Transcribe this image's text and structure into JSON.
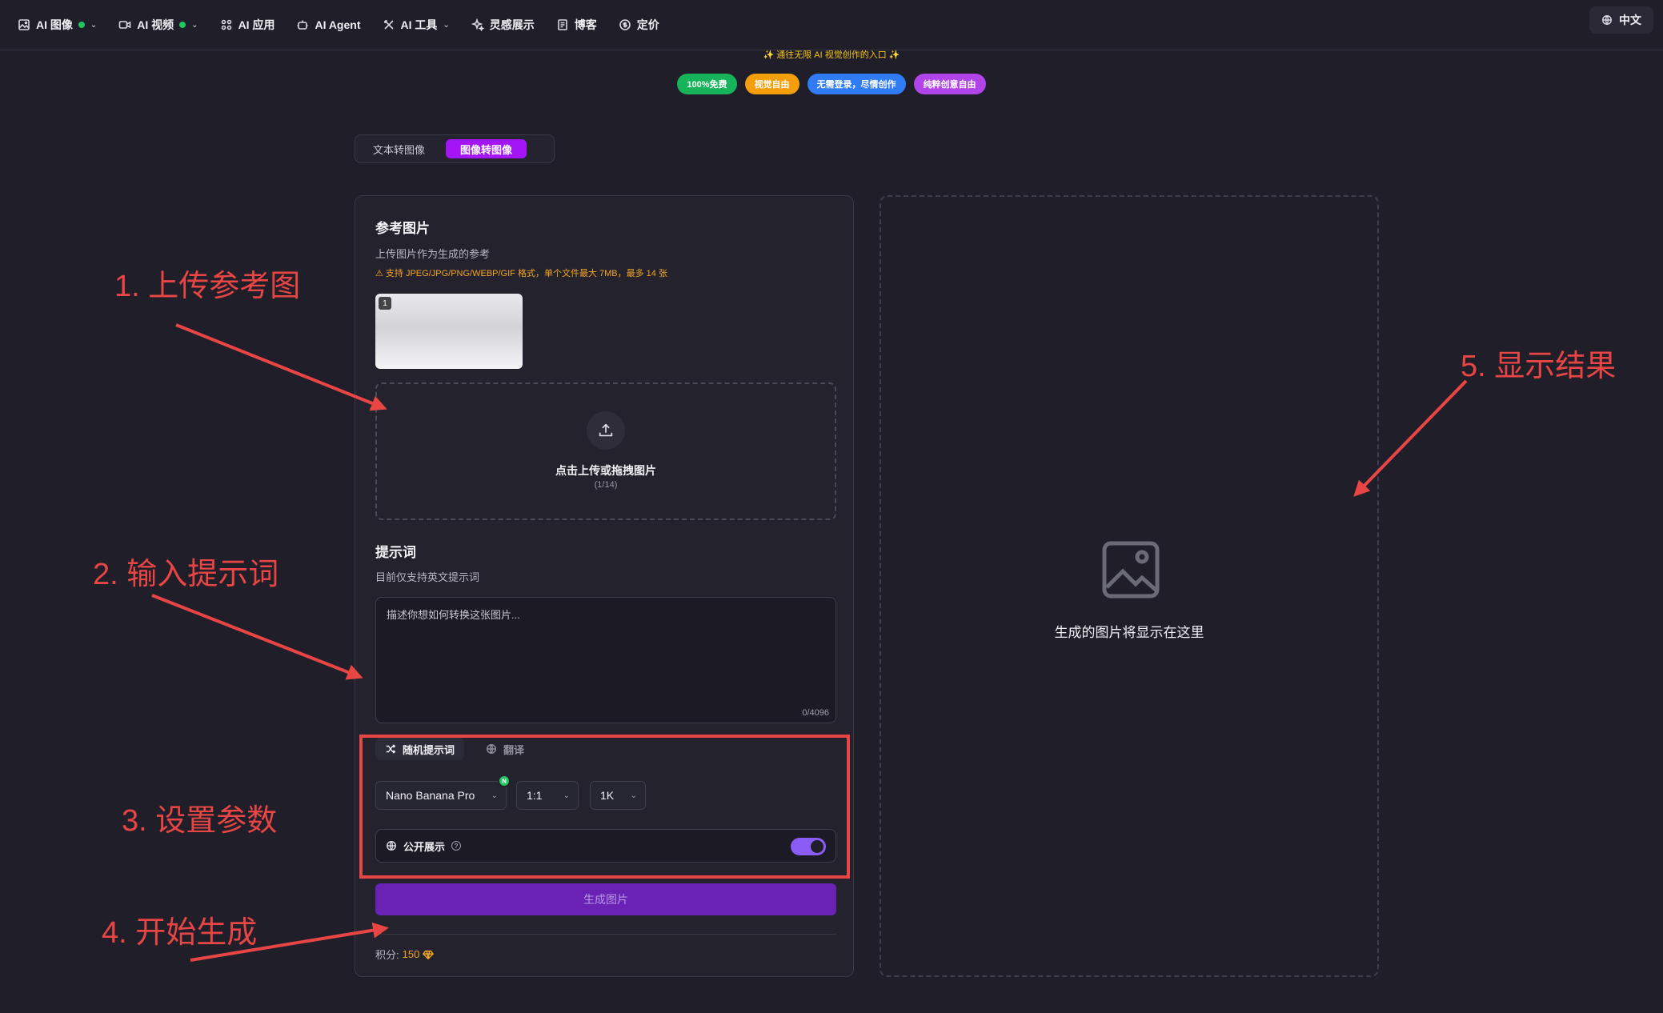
{
  "nav": {
    "items": [
      {
        "label": "AI 图像",
        "icon": "image-icon",
        "dot": true,
        "chevron": true
      },
      {
        "label": "AI 视频",
        "icon": "video-icon",
        "dot": true,
        "chevron": true
      },
      {
        "label": "AI 应用",
        "icon": "grid-icon",
        "dot": false,
        "chevron": false
      },
      {
        "label": "AI Agent",
        "icon": "robot-icon",
        "dot": false,
        "chevron": false
      },
      {
        "label": "AI 工具",
        "icon": "tools-icon",
        "dot": false,
        "chevron": true
      },
      {
        "label": "灵感展示",
        "icon": "sparkle-icon",
        "dot": false,
        "chevron": false
      },
      {
        "label": "博客",
        "icon": "document-icon",
        "dot": false,
        "chevron": false
      },
      {
        "label": "定价",
        "icon": "coin-icon",
        "dot": false,
        "chevron": false
      }
    ],
    "language": "中文"
  },
  "hero": {
    "tagline": "✨ 通往无限 AI 视觉创作的入口 ✨",
    "badges": [
      {
        "label": "100%免费",
        "color": "#16b35a"
      },
      {
        "label": "视觉自由",
        "color": "#f59e0b"
      },
      {
        "label": "无需登录，尽情创作",
        "color": "#2f7cf6"
      },
      {
        "label": "纯粹创意自由",
        "color": "#b044e8"
      }
    ]
  },
  "mode_tabs": {
    "text_to_image": "文本转图像",
    "image_to_image": "图像转图像",
    "active": "image_to_image"
  },
  "reference": {
    "title": "参考图片",
    "subtitle": "上传图片作为生成的参考",
    "warning": "⚠ 支持 JPEG/JPG/PNG/WEBP/GIF 格式，单个文件最大 7MB，最多 14 张",
    "thumb_index": "1",
    "upload_label": "点击上传或拖拽图片",
    "upload_count": "(1/14)"
  },
  "prompt": {
    "title": "提示词",
    "subtitle": "目前仅支持英文提示词",
    "placeholder": "描述你想如何转换这张图片...",
    "value": "",
    "counter": "0/4096"
  },
  "params": {
    "random_prompt": "随机提示词",
    "translate": "翻译",
    "model": "Nano Banana Pro",
    "model_badge": "N",
    "ratio": "1:1",
    "resolution": "1K",
    "public_label": "公开展示",
    "public_on": true
  },
  "generate": {
    "button": "生成图片",
    "points_label": "积分:",
    "points_value": "150"
  },
  "result": {
    "placeholder": "生成的图片将显示在这里"
  },
  "annotations": {
    "step1": "1. 上传参考图",
    "step2": "2. 输入提示词",
    "step3": "3. 设置参数",
    "step4": "4. 开始生成",
    "step5": "5. 显示结果",
    "color": "#e84545"
  }
}
